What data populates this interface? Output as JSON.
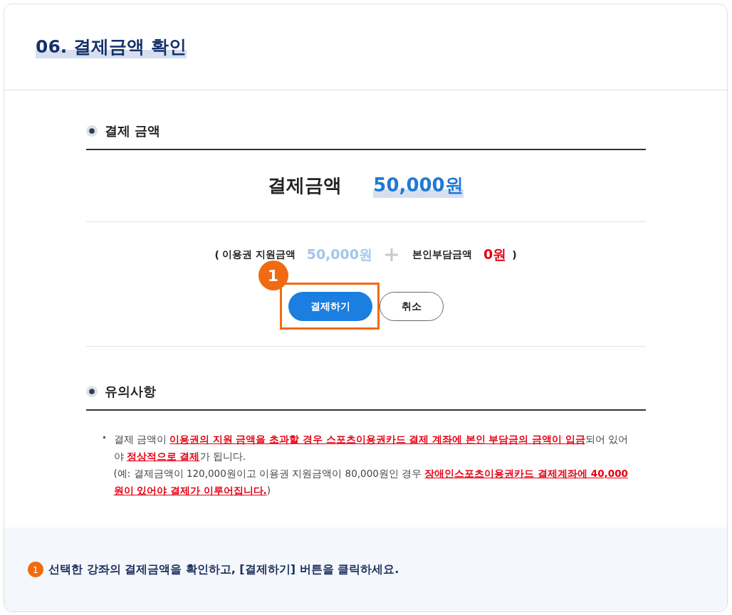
{
  "header": {
    "title": "06. 결제금액 확인"
  },
  "payment": {
    "heading": "결제 금액",
    "total": {
      "label": "결제금액",
      "value": "50,000원"
    },
    "breakdown": {
      "open": "(",
      "voucher_label": "이용권 지원금액",
      "voucher_value": "50,000원",
      "self_label": "본인부담금액",
      "self_value": "0원",
      "close": ")"
    },
    "buttons": [
      {
        "label": "결제하기",
        "kind": "primary",
        "highlighted": true,
        "marker": "1"
      },
      {
        "label": "취소",
        "kind": "secondary",
        "highlighted": false
      }
    ]
  },
  "notice": {
    "heading": "유의사항",
    "items": [
      "결제 금액이 **이용권의 지원 금액을 초과할 경우 스포츠이용권카드 결제 계좌에 본인 부담금의 금액이 입금**되어 있어야 **정상적으로 결제**가 됩니다.\n(예: 결제금액이 120,000원이고 이용권 지원금액이 80,000원인 경우 **장애인스포츠이용권카드 결제계좌에 40,000원이 있어야 결제가 이루어집니다.**)"
    ]
  },
  "guide": {
    "steps": [
      {
        "number": "1",
        "text": "선택한 강좌의 결제금액을 확인하고, [결제하기] 버튼을 클릭하세요."
      }
    ]
  }
}
